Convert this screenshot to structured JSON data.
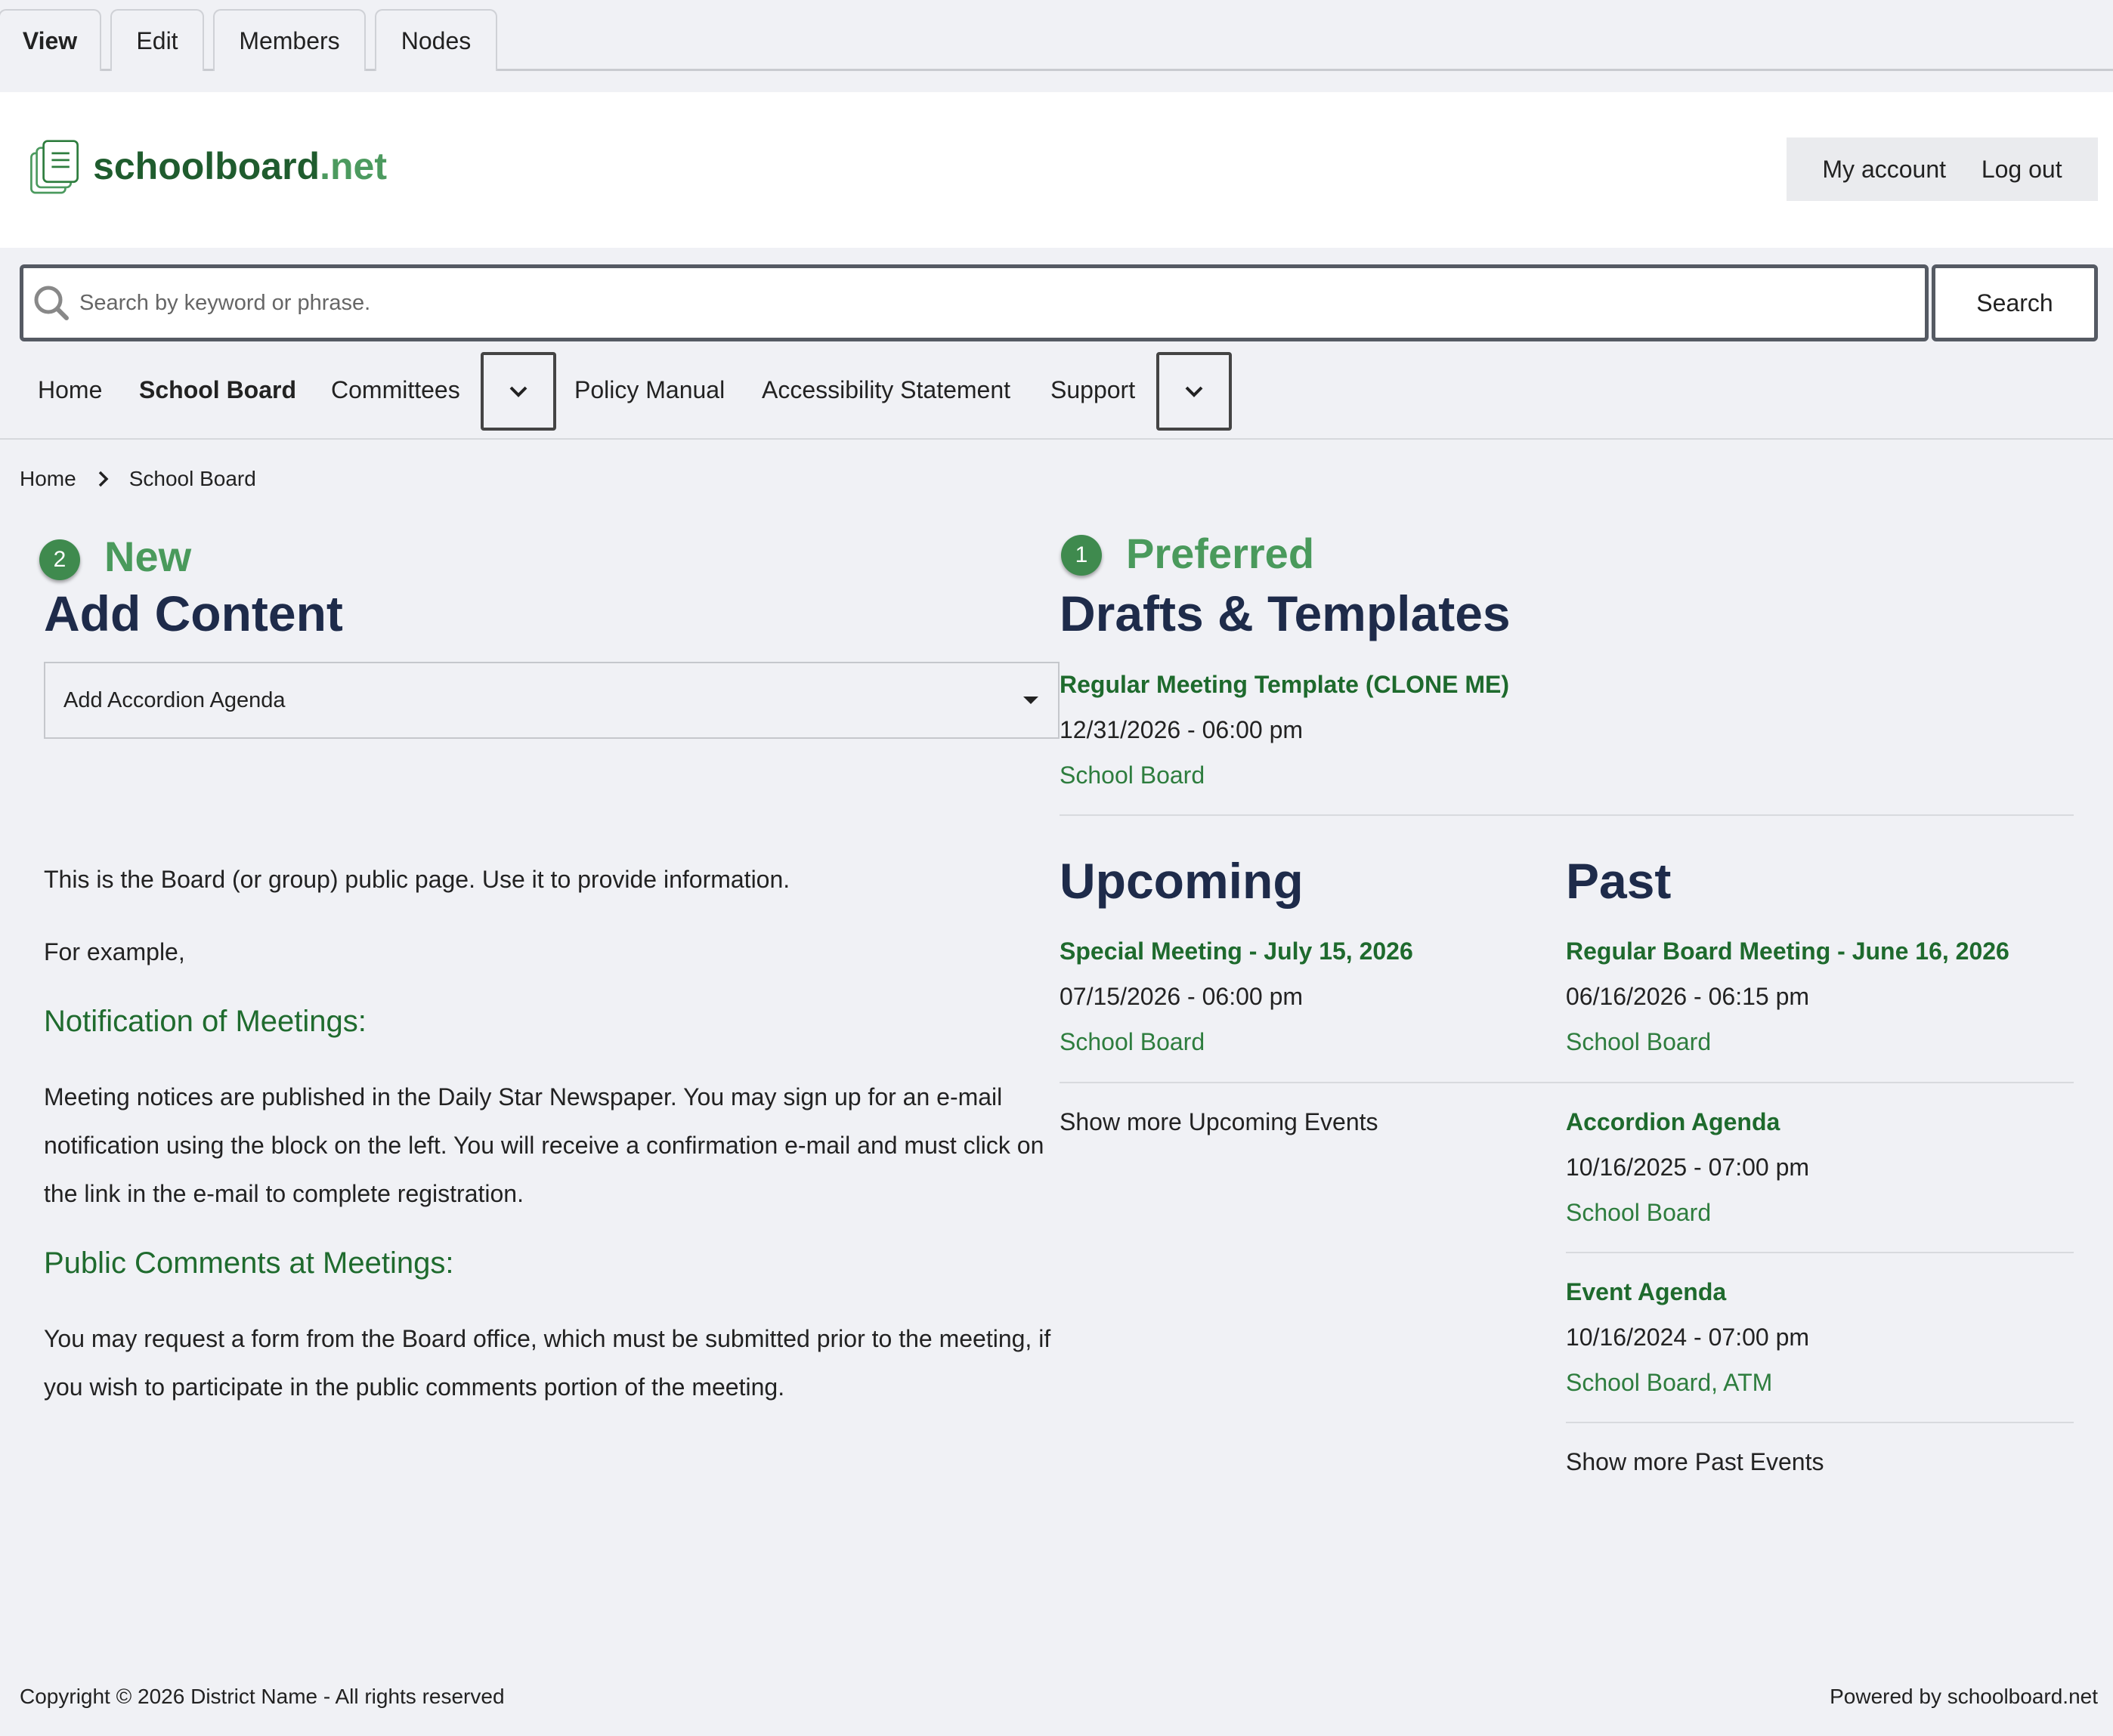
{
  "admin_tabs": [
    "View",
    "Edit",
    "Members",
    "Nodes"
  ],
  "brand": {
    "name": "schoolboard",
    "tld": ".net",
    "color": "#1f5c2e",
    "tld_color": "#4c9a5f"
  },
  "account": {
    "my_account": "My account",
    "logout": "Log out"
  },
  "search": {
    "placeholder": "Search by keyword or phrase.",
    "button": "Search"
  },
  "nav": {
    "items": [
      "Home",
      "School Board",
      "Committees",
      "Policy Manual",
      "Accessibility Statement",
      "Support"
    ],
    "active": "School Board",
    "toggle_icon": "chevron-down-icon"
  },
  "breadcrumb": [
    "Home",
    "School Board"
  ],
  "new_section": {
    "badge": "2",
    "kicker": "New",
    "heading": "Add Content",
    "select_value": "Add Accordion Agenda"
  },
  "body": {
    "intro": "This is the Board (or group) public page.  Use it to provide information.",
    "example": "For example,",
    "heading1": "Notification of Meetings:",
    "para1": "Meeting notices are published in the Daily Star Newspaper.  You may sign up for an e-mail notification using the block on the left.  You will receive a confirmation e-mail and must click on the link in the e-mail to complete registration.",
    "heading2": "Public Comments at Meetings:",
    "para2": "You may request a form from the Board office, which must be submitted prior to the meeting, if you wish to participate in the public comments portion of the meeting."
  },
  "preferred_section": {
    "badge": "1",
    "kicker": "Preferred",
    "heading": "Drafts & Templates",
    "items": [
      {
        "title": "Regular Meeting Template (CLONE ME)",
        "date": "12/31/2026 - 06:00 pm",
        "category": "School Board"
      }
    ]
  },
  "upcoming": {
    "heading": "Upcoming",
    "items": [
      {
        "title": "Special Meeting - July 15, 2026",
        "date": "07/15/2026 - 06:00 pm",
        "category": "School Board"
      }
    ],
    "more": "Show more Upcoming Events"
  },
  "past": {
    "heading": "Past",
    "items": [
      {
        "title": "Regular Board Meeting - June 16, 2026",
        "date": "06/16/2026 - 06:15 pm",
        "category": "School Board"
      },
      {
        "title": "Accordion Agenda",
        "date": "10/16/2025 - 07:00 pm",
        "category": "School Board"
      },
      {
        "title": "Event Agenda",
        "date": "10/16/2024 - 07:00 pm",
        "category": "School Board",
        "category2": "ATM"
      }
    ],
    "more": "Show more Past Events"
  },
  "footer": {
    "copyright": "Copyright © 2026 District Name - All rights reserved",
    "powered": "Powered by schoolboard.net"
  },
  "colors": {
    "accent_green": "#3f8a4e",
    "heading_navy": "#1e2b4a",
    "link_green": "#1e6a2d"
  }
}
